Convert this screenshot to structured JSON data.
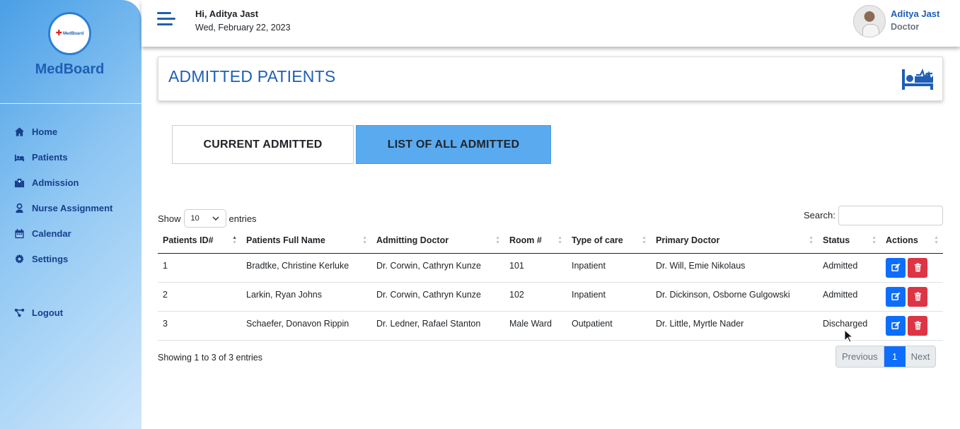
{
  "app": {
    "brand": "MedBoard",
    "logo_text": "MedBoard"
  },
  "sidebar": {
    "items": [
      {
        "label": "Home",
        "icon": "home-icon"
      },
      {
        "label": "Patients",
        "icon": "bed-icon"
      },
      {
        "label": "Admission",
        "icon": "hospital-icon"
      },
      {
        "label": "Nurse Assignment",
        "icon": "nurse-icon"
      },
      {
        "label": "Calendar",
        "icon": "calendar-icon"
      },
      {
        "label": "Settings",
        "icon": "gear-icon"
      }
    ],
    "logout_label": "Logout"
  },
  "header": {
    "greeting": "Hi, Aditya Jast",
    "date": "Wed, February 22, 2023",
    "user_name": "Aditya Jast",
    "user_role": "Doctor"
  },
  "page": {
    "title": "ADMITTED PATIENTS"
  },
  "tabs": {
    "current": "CURRENT ADMITTED",
    "all": "LIST OF ALL ADMITTED"
  },
  "table_controls": {
    "show_label": "Show",
    "entries_value": "10",
    "entries_label": "entries",
    "search_label": "Search:",
    "search_value": ""
  },
  "table": {
    "columns": [
      "Patients ID#",
      "Patients Full Name",
      "Admitting Doctor",
      "Room #",
      "Type of care",
      "Primary Doctor",
      "Status",
      "Actions"
    ],
    "rows": [
      {
        "id": "1",
        "name": "Bradtke, Christine Kerluke",
        "admitting": "Dr. Corwin, Cathryn Kunze",
        "room": "101",
        "care": "Inpatient",
        "primary": "Dr. Will, Emie Nikolaus",
        "status": "Admitted"
      },
      {
        "id": "2",
        "name": "Larkin, Ryan Johns",
        "admitting": "Dr. Corwin, Cathryn Kunze",
        "room": "102",
        "care": "Inpatient",
        "primary": "Dr. Dickinson, Osborne Gulgowski",
        "status": "Admitted"
      },
      {
        "id": "3",
        "name": "Schaefer, Donavon Rippin",
        "admitting": "Dr. Ledner, Rafael Stanton",
        "room": "Male Ward",
        "care": "Outpatient",
        "primary": "Dr. Little, Myrtle Nader",
        "status": "Discharged"
      }
    ]
  },
  "footer": {
    "info": "Showing 1 to 3 of 3 entries",
    "previous": "Previous",
    "page": "1",
    "next": "Next"
  },
  "colors": {
    "brand": "#1f5fb5",
    "tab_active": "#5aaaf0",
    "edit": "#0d6efd",
    "delete": "#dc3545"
  }
}
